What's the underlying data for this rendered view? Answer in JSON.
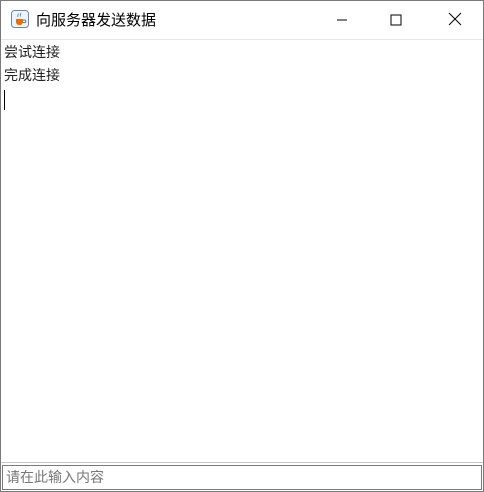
{
  "window": {
    "title": "向服务器发送数据",
    "app_icon": "java-coffee-cup-icon",
    "controls": [
      "minimize-icon",
      "maximize-icon",
      "close-icon"
    ]
  },
  "log": {
    "lines": [
      "尝试连接",
      "完成连接"
    ]
  },
  "input": {
    "value": "",
    "placeholder": "请在此输入内容"
  },
  "colors": {
    "window_bg": "#ffffff",
    "border": "#7a7a7a",
    "text": "#222222"
  }
}
